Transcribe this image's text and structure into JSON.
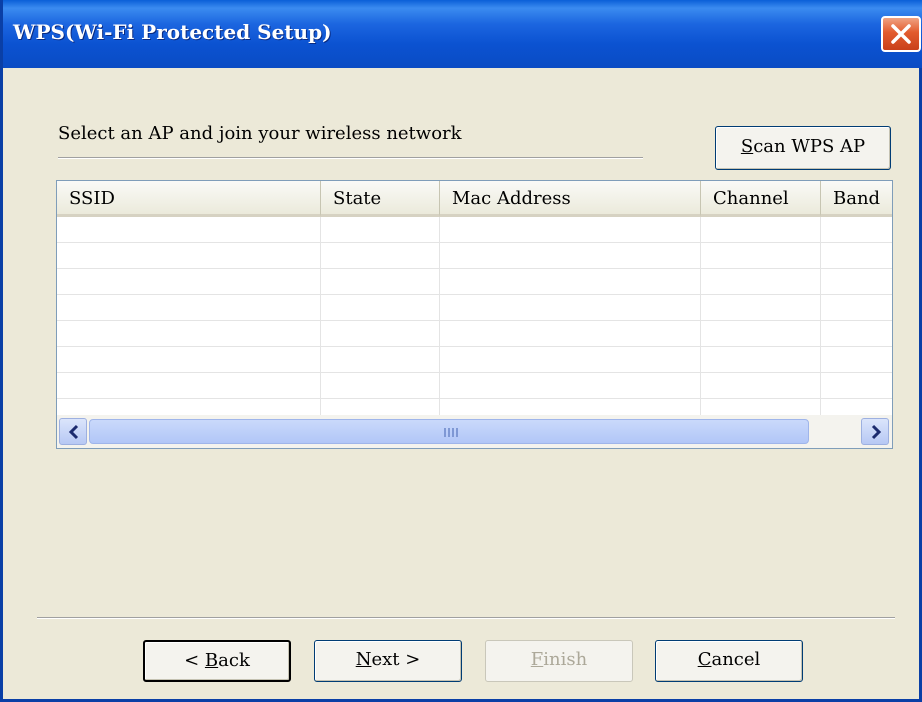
{
  "window": {
    "title": "WPS(Wi-Fi Protected Setup)",
    "colors": {
      "titlebar": "#0b52d1",
      "background": "#ece9d8",
      "close": "#e25b2d"
    }
  },
  "instruction": "Select an AP and join your wireless network",
  "scan_button": {
    "mnemonic": "S",
    "rest": "can WPS AP"
  },
  "table": {
    "columns": [
      "SSID",
      "State",
      "Mac Address",
      "Channel",
      "Band"
    ],
    "rows": []
  },
  "scrollbar": {
    "left_icon": "chevron-left-icon",
    "right_icon": "chevron-right-icon"
  },
  "buttons": {
    "back": {
      "prefix": "< ",
      "mnemonic": "B",
      "rest": "ack",
      "enabled": true
    },
    "next": {
      "prefix": "",
      "mnemonic": "N",
      "rest": "ext >",
      "enabled": true
    },
    "finish": {
      "prefix": "",
      "mnemonic": "F",
      "rest": "inish",
      "enabled": false
    },
    "cancel": {
      "prefix": "",
      "mnemonic": "C",
      "rest": "ancel",
      "enabled": true
    }
  }
}
